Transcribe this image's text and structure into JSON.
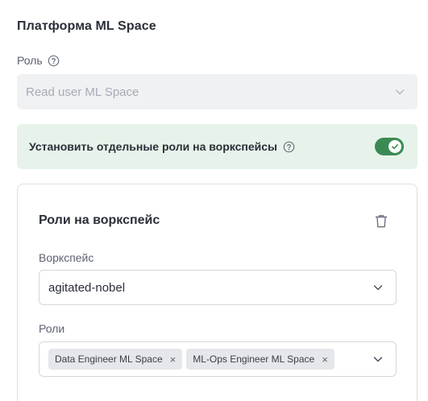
{
  "section": {
    "title": "Платформа ML Space"
  },
  "role": {
    "label": "Роль",
    "value": "Read user ML Space"
  },
  "toggle": {
    "label": "Установить отдельные роли на воркспейсы",
    "checked": true,
    "accent": "#3b8a54",
    "background": "#e7f3ea"
  },
  "workspace_card": {
    "title": "Роли на воркспейс",
    "workspace": {
      "label": "Воркспейс",
      "value": "agitated-nobel"
    },
    "roles": {
      "label": "Роли",
      "chips": [
        "Data Engineer ML Space",
        "ML-Ops Engineer ML Space"
      ],
      "remove_glyph": "×"
    }
  },
  "icons": [
    "help-icon",
    "chevron-down-icon",
    "check-icon",
    "trash-icon",
    "close-icon"
  ]
}
